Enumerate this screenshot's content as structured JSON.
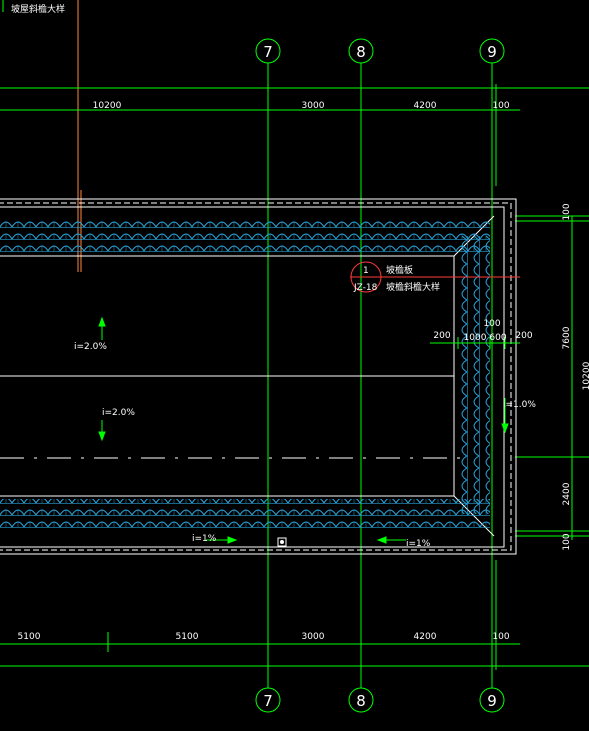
{
  "colors": {
    "background": "#000000",
    "axis": "#00ff00",
    "text": "#ffffff",
    "tile": "#29a8e0",
    "outline": "#ffffff",
    "accent": "#ff8a3d",
    "detail": "#ff3b3b",
    "slope_arrow": "#00ff00"
  },
  "header_note": "坡屋斜檐大样",
  "axes": [
    "7",
    "8",
    "9"
  ],
  "top_dimensions": [
    "10200",
    "3000",
    "4200",
    "100"
  ],
  "bottom_dimensions": [
    "5100",
    "5100",
    "3000",
    "4200",
    "100"
  ],
  "right_dimensions": [
    "100",
    "7600",
    "2400",
    "100"
  ],
  "right_overall": "10200",
  "eave_dimensions": [
    "200",
    "1000",
    "600",
    "200",
    "100"
  ],
  "slopes": {
    "left_top": "i=2.0%",
    "left_bottom": "i=2.0%",
    "right": "i=1.0%",
    "bottom_left": "i=1%",
    "bottom_right": "i=1%"
  },
  "detail_callout": {
    "number": "1",
    "sheet": "JZ-18",
    "label_top": "坡檐板",
    "label_bottom": "坡檐斜檐大样"
  }
}
